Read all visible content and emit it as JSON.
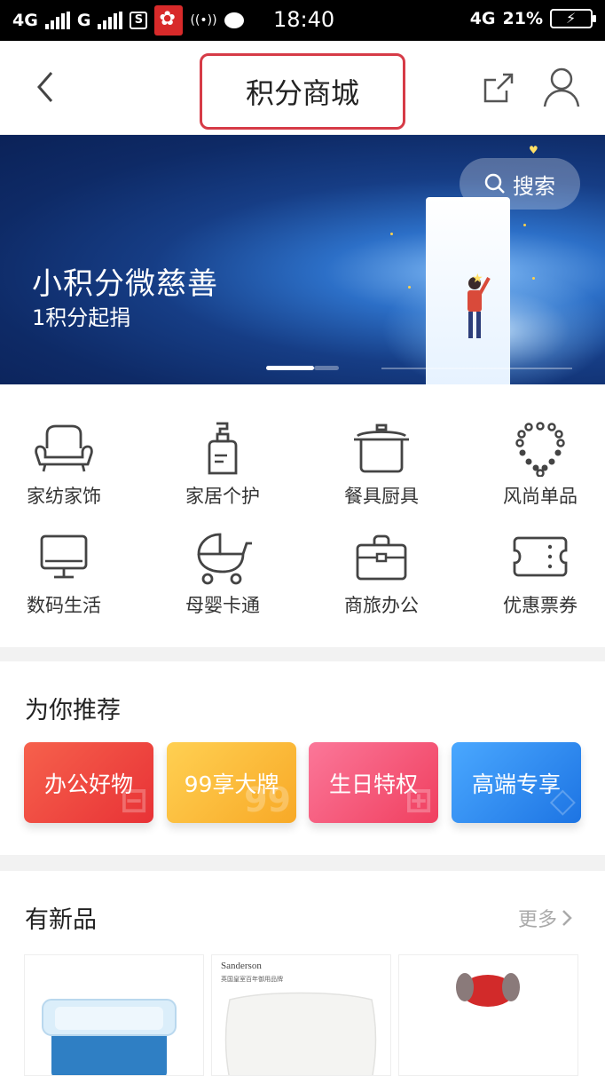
{
  "status_bar": {
    "network1": "4G",
    "network2": "G",
    "sim_badge": "S",
    "time": "18:40",
    "network3": "4G",
    "battery": "21%"
  },
  "header": {
    "title": "积分商城"
  },
  "banner": {
    "title": "小积分微慈善",
    "subtitle": "1积分起捐",
    "search_label": "搜索",
    "active_slide": 1,
    "slide_count": 2
  },
  "categories": [
    {
      "label": "家纺家饰",
      "icon": "sofa-icon"
    },
    {
      "label": "家居个护",
      "icon": "lotion-bottle-icon"
    },
    {
      "label": "餐具厨具",
      "icon": "pot-icon"
    },
    {
      "label": "风尚单品",
      "icon": "necklace-icon"
    },
    {
      "label": "数码生活",
      "icon": "monitor-icon"
    },
    {
      "label": "母婴卡通",
      "icon": "stroller-icon"
    },
    {
      "label": "商旅办公",
      "icon": "briefcase-icon"
    },
    {
      "label": "优惠票券",
      "icon": "ticket-icon"
    }
  ],
  "recommend": {
    "title": "为你推荐",
    "cards": [
      {
        "label": "办公好物",
        "color": "#ef4a42"
      },
      {
        "label": "99享大牌",
        "color": "#fbbf3a"
      },
      {
        "label": "生日特权",
        "color": "#f35b7d"
      },
      {
        "label": "高端专享",
        "color": "#2f8ff0"
      }
    ]
  },
  "new_products": {
    "title": "有新品",
    "more_label": "更多",
    "items": [
      {
        "brand": ""
      },
      {
        "brand": "Sanderson",
        "brand_sub": "英国皇室百年御用品牌"
      },
      {
        "brand": ""
      }
    ]
  },
  "colors": {
    "accent_red": "#d63b47",
    "divider": "#f2f2f2"
  }
}
